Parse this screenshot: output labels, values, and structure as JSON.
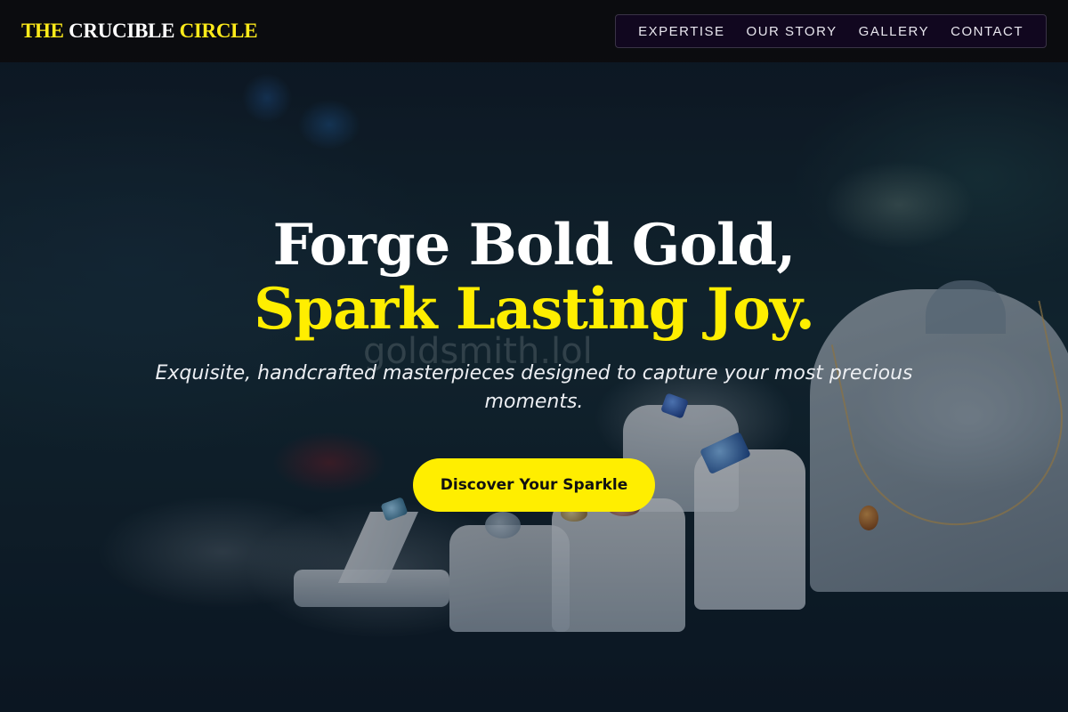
{
  "brand": {
    "part1": "THE",
    "part2": "CRUCIBLE",
    "part3": "CIRCLE"
  },
  "nav": {
    "items": [
      {
        "label": "EXPERTISE"
      },
      {
        "label": "OUR STORY"
      },
      {
        "label": "GALLERY"
      },
      {
        "label": "CONTACT"
      }
    ]
  },
  "hero": {
    "headline_line1": "Forge Bold Gold,",
    "headline_line2": "Spark Lasting Joy.",
    "subheadline": "Exquisite, handcrafted masterpieces designed to capture your most precious moments.",
    "cta_label": "Discover Your Sparkle",
    "watermark": "goldsmith.lol"
  },
  "colors": {
    "accent_yellow": "#ffee00",
    "header_bg": "#0c0c0e",
    "nav_bg": "#11071f"
  }
}
